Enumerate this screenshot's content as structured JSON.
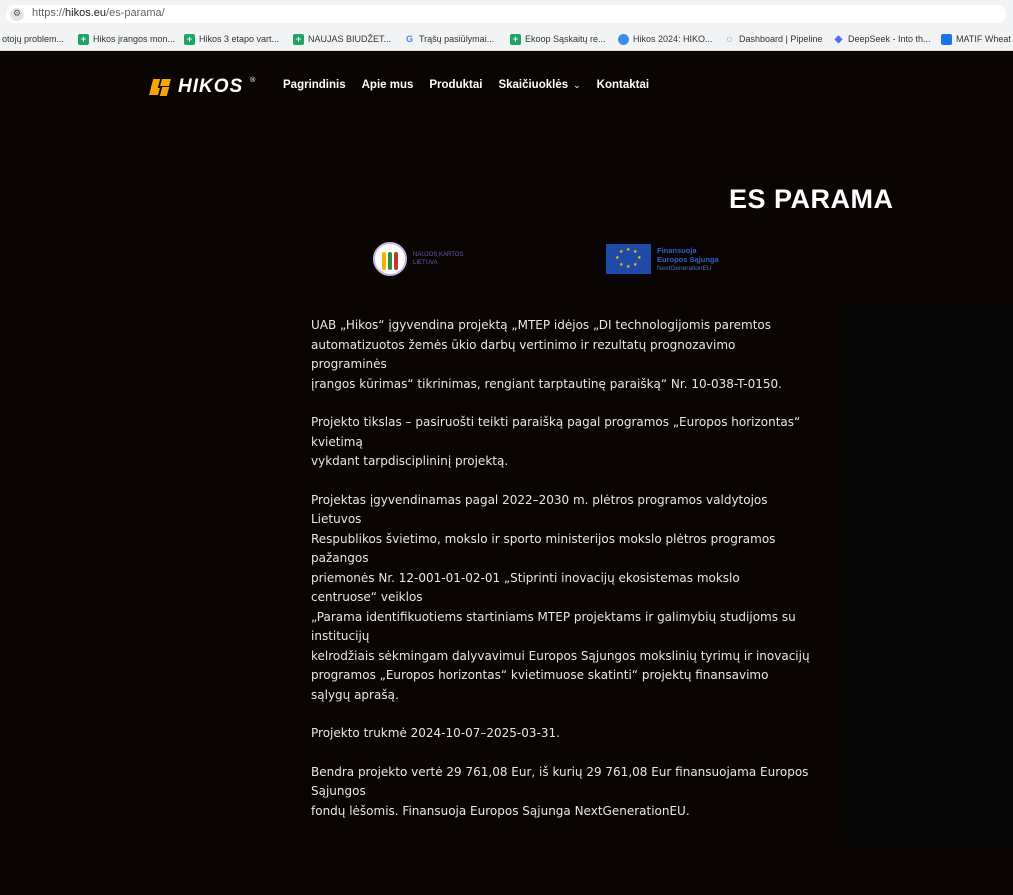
{
  "browser": {
    "url_prefix": "https://",
    "url_host": "hikos.eu",
    "url_path": "/es-parama/",
    "bookmarks": [
      {
        "label": "otojų problem...",
        "icon": "none"
      },
      {
        "label": "Hikos įrangos mon...",
        "icon": "sheets-icon"
      },
      {
        "label": "Hikos 3 etapo vart...",
        "icon": "sheets-icon"
      },
      {
        "label": "NAUJAS BIUDŽET...",
        "icon": "sheets-icon"
      },
      {
        "label": "Trąšų pasiūlymai...",
        "icon": "google-icon"
      },
      {
        "label": "Ekoop Sąskaitų re...",
        "icon": "sheets-icon"
      },
      {
        "label": "Hikos 2024: HIKO...",
        "icon": "drive-icon"
      },
      {
        "label": "Dashboard | Pipeline",
        "icon": "pipeline-icon"
      },
      {
        "label": "DeepSeek - Into th...",
        "icon": "deepseek-icon"
      },
      {
        "label": "MATIF Wheat |",
        "icon": "matif-icon"
      }
    ]
  },
  "header": {
    "brand": "HIKOS",
    "brand_reg": "®",
    "nav": [
      "Pagrindinis",
      "Apie mus",
      "Produktai",
      "Skaičiuoklės",
      "Kontaktai"
    ]
  },
  "page": {
    "title": "ES PARAMA",
    "logo1_lines": [
      "NAUJOS KARTOS",
      "LIETUVA"
    ],
    "logo2_lines": [
      "Finansuoja",
      "Europos Sąjunga",
      "NextGenerationEU"
    ],
    "paragraphs": [
      [
        "UAB „Hikos“ įgyvendina projektą „MTEP idėjos „DI technologijomis paremtos",
        "automatizuotos žemės ūkio darbų vertinimo ir rezultatų prognozavimo",
        "programinės",
        "įrangos kūrimas“ tikrinimas, rengiant tarptautinę paraišką“ Nr. 10-038-T-0150."
      ],
      [
        "Projekto tikslas – pasiruošti teikti paraišką pagal programos „Europos horizontas“",
        "kvietimą",
        "vykdant tarpdisciplininį projektą."
      ],
      [
        "Projektas įgyvendinamas pagal 2022–2030 m. plėtros programos valdytojos",
        "Lietuvos",
        "Respublikos švietimo, mokslo ir sporto ministerijos mokslo plėtros programos",
        "pažangos",
        "priemonės Nr. 12-001-01-02-01 „Stiprinti inovacijų ekosistemas mokslo",
        "centruose“ veiklos",
        "„Parama identifikuotiems startiniams MTEP projektams ir galimybių studijoms su",
        "institucijų",
        "kelrodžiais sėkmingam dalyvavimui Europos Sąjungos mokslinių tyrimų ir inovacijų",
        "programos „Europos horizontas“ kvietimuose skatinti“ projektų finansavimo",
        "sąlygų aprašą."
      ],
      [
        "Projekto trukmė 2024-10-07–2025-03-31."
      ],
      [
        "Bendra projekto vertė 29 761,08 Eur, iš kurių 29 761,08 Eur finansuojama Europos",
        "Sąjungos",
        "fondų lėšomis. Finansuoja Europos Sąjunga NextGenerationEU."
      ]
    ]
  }
}
